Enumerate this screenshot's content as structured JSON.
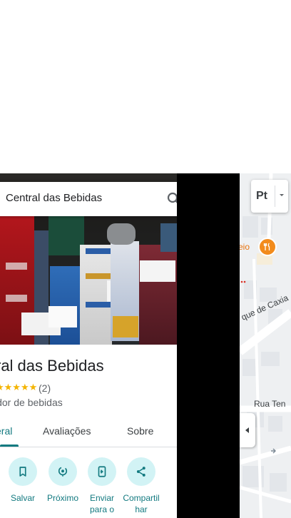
{
  "search": {
    "query": "Central das Bebidas"
  },
  "place": {
    "title": "ral das Bebidas",
    "stars": "★★★★★",
    "review_count": "(2)",
    "category": "idor de bebidas"
  },
  "tabs": [
    {
      "label": "eral"
    },
    {
      "label": "Avaliações"
    },
    {
      "label": "Sobre"
    }
  ],
  "actions": [
    {
      "label": "Salvar",
      "icon": "bookmark-icon"
    },
    {
      "label": "Próximo",
      "icon": "nearby-icon"
    },
    {
      "label": "Enviar para o",
      "icon": "send-to-phone-icon"
    },
    {
      "label": "Compartilhar",
      "icon": "share-icon"
    }
  ],
  "map": {
    "poi_label": "eio",
    "street_1": "que de Caxia",
    "street_2": "Rua Ten",
    "layer_label": "Pt"
  },
  "colors": {
    "accent": "#137a80",
    "chip_bg": "#d2f3f5",
    "star": "#f4b400",
    "poi": "#f28b1c"
  }
}
